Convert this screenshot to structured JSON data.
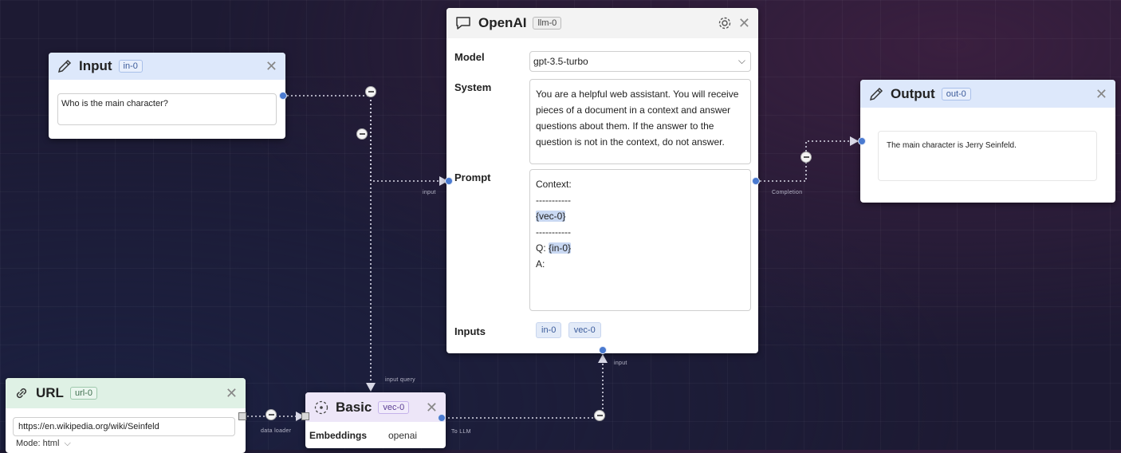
{
  "input_node": {
    "title": "Input",
    "tag": "in-0",
    "value": "Who is the main character?"
  },
  "openai_node": {
    "title": "OpenAI",
    "tag": "llm-0",
    "model_label": "Model",
    "model_value": "gpt-3.5-turbo",
    "system_label": "System",
    "system_value": "You are a helpful web assistant. You will receive pieces of a document in a context and answer questions about them. If the answer to the question is not in the context, do not answer.",
    "prompt_label": "Prompt",
    "prompt_lines": {
      "l1": "Context:",
      "l2": "-----------",
      "l3": "{vec-0}",
      "l4": "-----------",
      "l5_prefix": "Q: ",
      "l5_var": "{in-0}",
      "l6": "A:"
    },
    "inputs_label": "Inputs",
    "inputs": [
      "in-0",
      "vec-0"
    ]
  },
  "output_node": {
    "title": "Output",
    "tag": "out-0",
    "value": "The main character is Jerry Seinfeld."
  },
  "url_node": {
    "title": "URL",
    "tag": "url-0",
    "value": "https://en.wikipedia.org/wiki/Seinfeld",
    "mode": "Mode: html"
  },
  "basic_node": {
    "title": "Basic",
    "tag": "vec-0",
    "embeddings_label": "Embeddings",
    "embeddings_value": "openai"
  },
  "edge_labels": {
    "input": "input",
    "completion": "Completion",
    "input_query": "input query",
    "data_loader": "data loader",
    "to_llm": "To LLM",
    "llm_input": "input"
  },
  "icons": {
    "input": "pencil-icon",
    "output": "pencil-icon",
    "openai": "chat-bubble-icon",
    "settings": "gear-icon",
    "close": "close-icon",
    "url": "link-icon",
    "basic": "vector-db-icon",
    "dropdown": "chevron-down-icon",
    "remove_edge": "minus-circle-icon"
  },
  "colors": {
    "input_header": "#dde8fb",
    "output_header": "#dde8fb",
    "url_header": "#dff1e5",
    "basic_header": "#ede6f8",
    "openai_header": "#f3f3f3",
    "edge": "#d8d8e6",
    "handle": "#4a7ad0"
  }
}
